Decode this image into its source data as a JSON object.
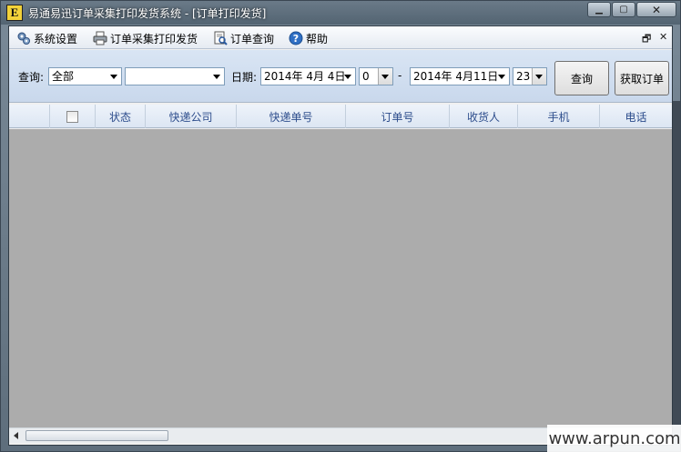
{
  "window": {
    "title": "易通易迅订单采集打印发货系统 - [订单打印发货]",
    "icon_letter": "E"
  },
  "menubar": {
    "items": [
      {
        "label": "系统设置",
        "icon": "settings-icon"
      },
      {
        "label": "订单采集打印发货",
        "icon": "printer-icon"
      },
      {
        "label": "订单查询",
        "icon": "document-search-icon"
      },
      {
        "label": "帮助",
        "icon": "help-icon"
      }
    ]
  },
  "query": {
    "query_label": "查询",
    "query_colon": ":",
    "type_value": "全部",
    "keyword_value": "",
    "date_label": "日期",
    "date_colon": ":",
    "start_date": "2014年  4月  4日",
    "start_hour": "0",
    "dash": "-",
    "end_date": "2014年  4月11日",
    "end_hour": "23",
    "search_button": "查询",
    "fetch_button": "获取订单"
  },
  "grid": {
    "columns": [
      "状态",
      "快递公司",
      "快递单号",
      "订单号",
      "收货人",
      "手机",
      "电话"
    ],
    "rows": []
  },
  "watermark": "www.arpun.com",
  "colors": {
    "grid_body": "#acacac",
    "header_text": "#2d4d8c",
    "querybar": "#d3e0f1"
  }
}
